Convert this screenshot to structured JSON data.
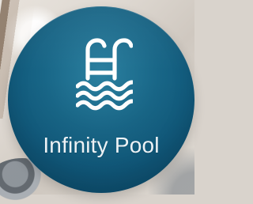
{
  "tile": {
    "label": "Infinity Pool",
    "icon": "pool-ladder-icon",
    "background_color": "#176a8d",
    "icon_color": "#ffffff",
    "text_color": "#f3f8fb"
  }
}
